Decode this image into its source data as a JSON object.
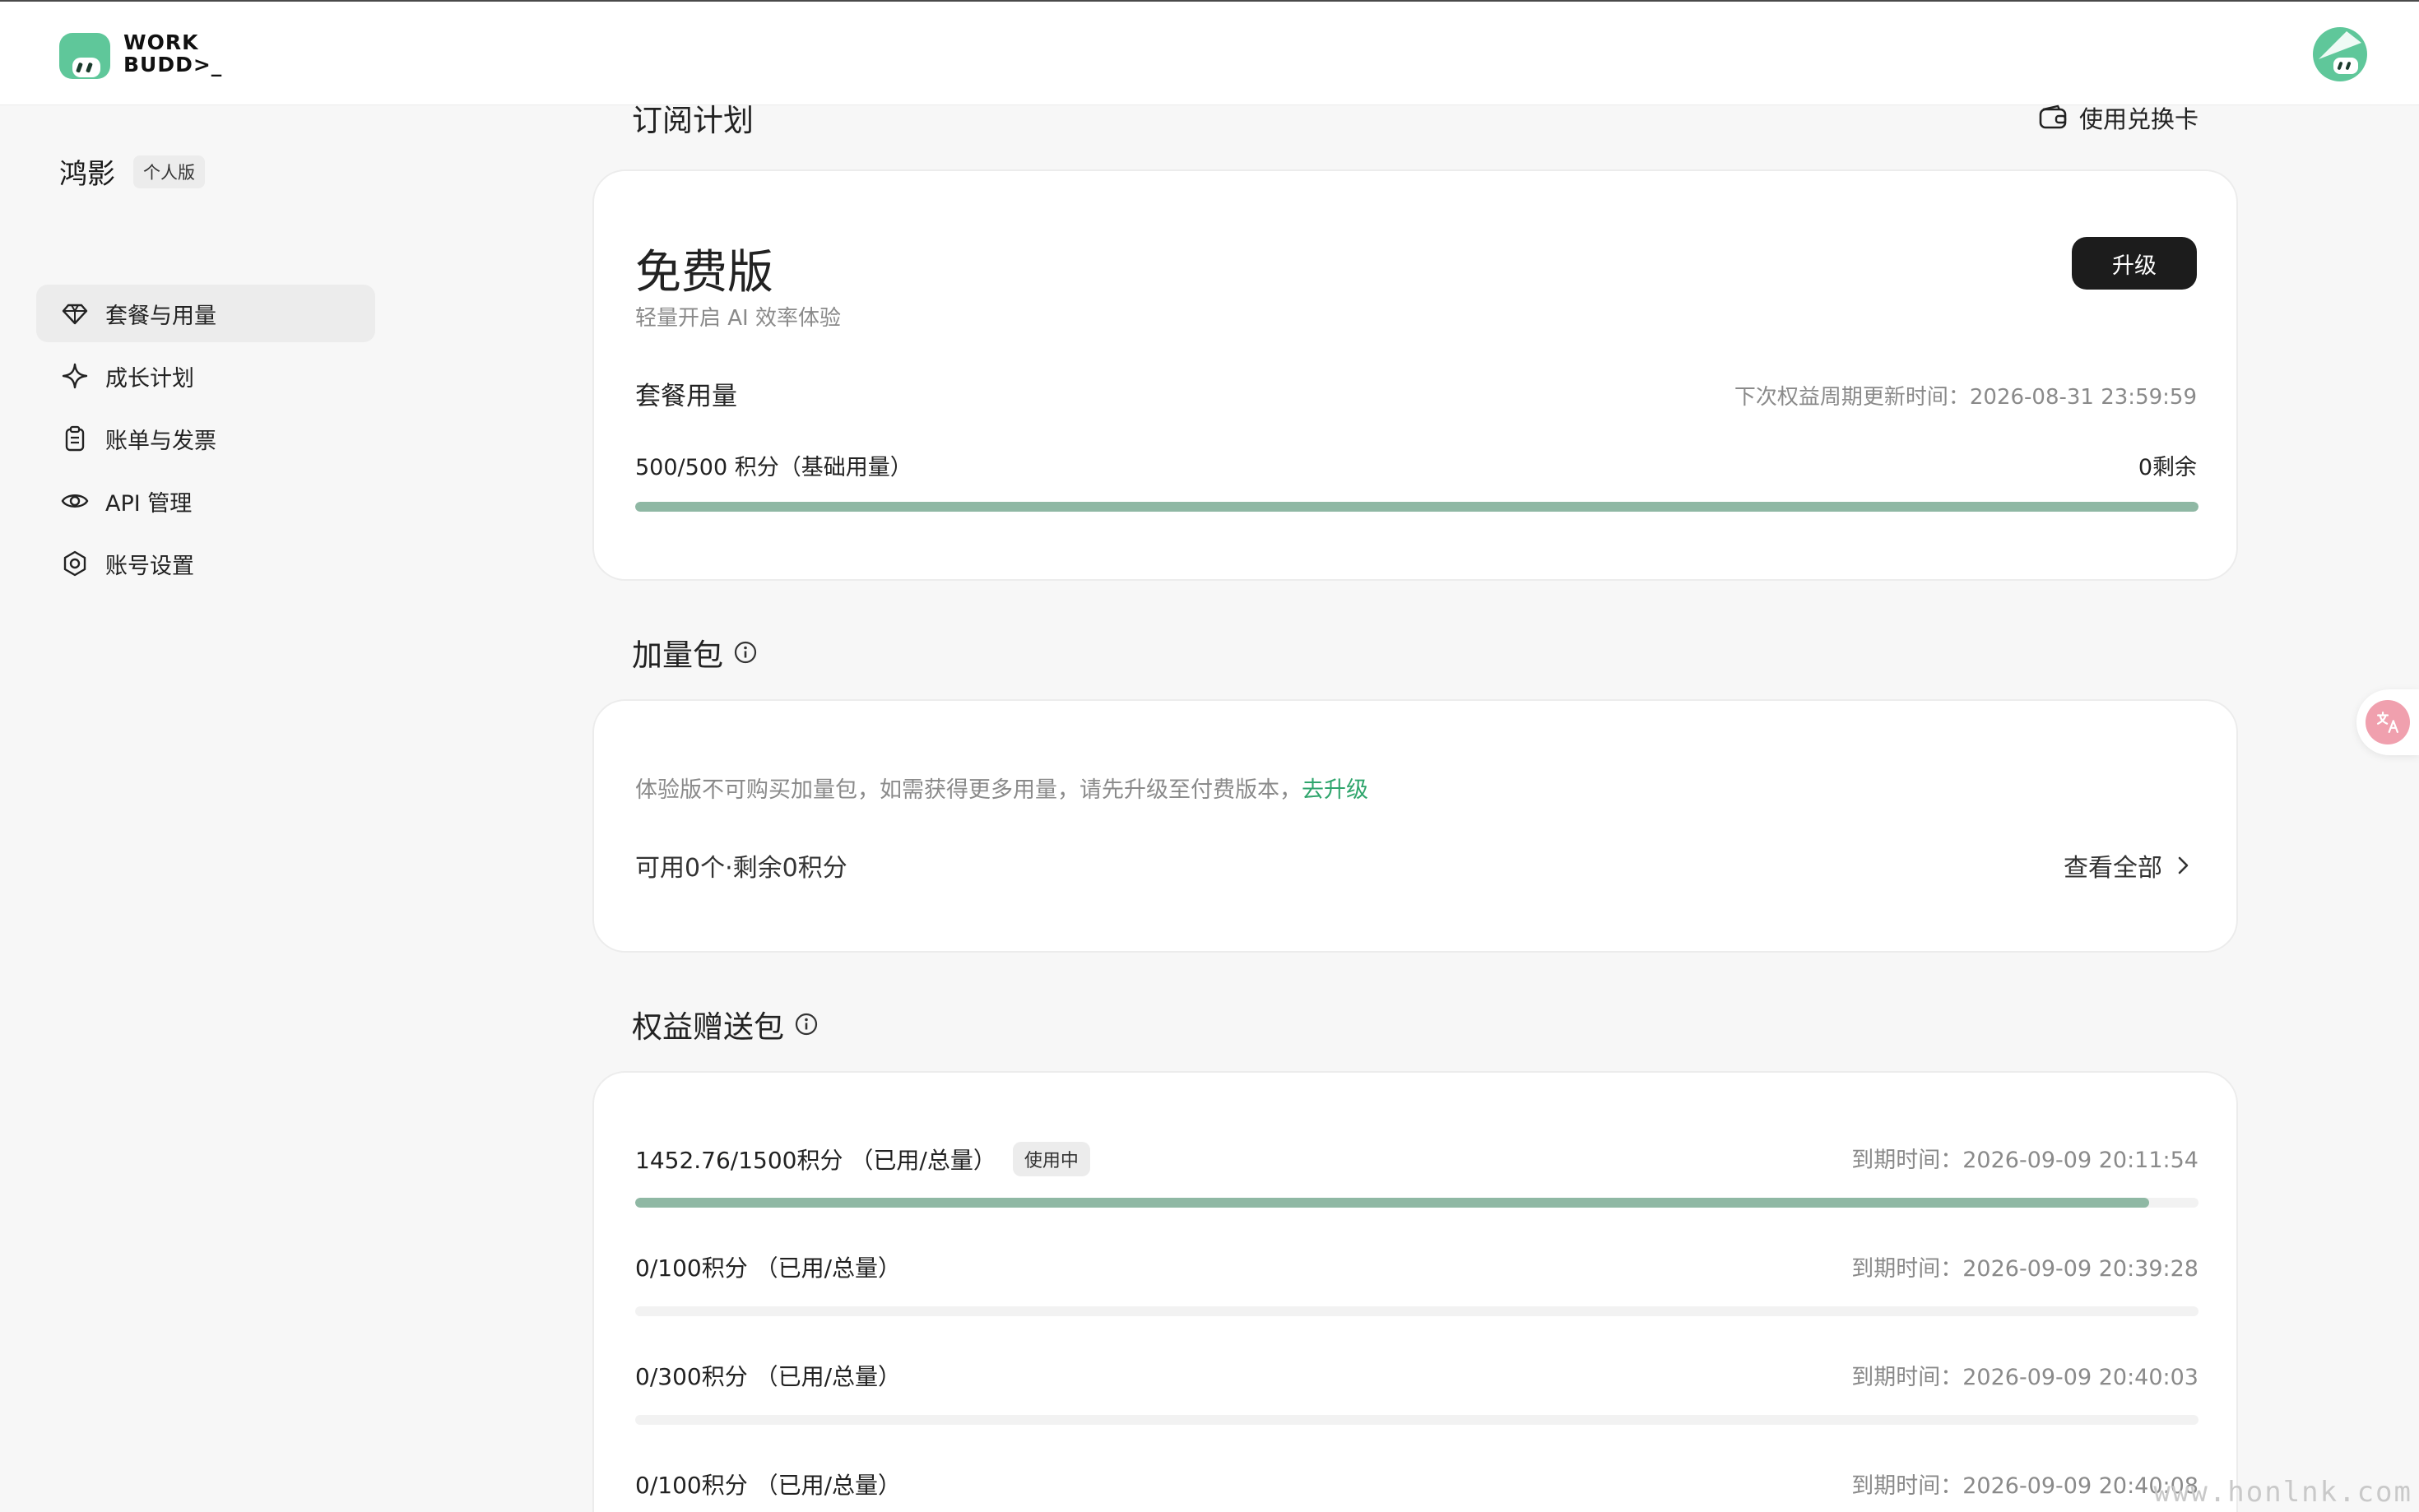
{
  "header": {
    "logo_line1": "WORK",
    "logo_line2": "BUDD>_"
  },
  "sidebar": {
    "org_name": "鸿影",
    "org_tag": "个人版",
    "items": [
      {
        "label": "套餐与用量",
        "icon": "gem-icon",
        "active": true
      },
      {
        "label": "成长计划",
        "icon": "sparkle-icon",
        "active": false
      },
      {
        "label": "账单与发票",
        "icon": "clipboard-icon",
        "active": false
      },
      {
        "label": "API 管理",
        "icon": "eye-icon",
        "active": false
      },
      {
        "label": "账号设置",
        "icon": "settings-icon",
        "active": false
      }
    ]
  },
  "subscription": {
    "title": "订阅计划",
    "redeem_label": "使用兑换卡",
    "plan_name": "免费版",
    "plan_desc": "轻量开启 AI 效率体验",
    "upgrade_label": "升级",
    "usage_title": "套餐用量",
    "refresh_time": "下次权益周期更新时间：2026-08-31 23:59:59",
    "usage_text": "500/500 积分（基础用量）",
    "remaining": "0剩余",
    "usage_fraction": 1.0
  },
  "addon": {
    "title": "加量包",
    "note": "体验版不可购买加量包，如需获得更多用量，请先升级至付费版本，",
    "note_link": "去升级",
    "available": "可用0个·剩余0积分",
    "view_all": "查看全部"
  },
  "gifts": {
    "title": "权益赠送包",
    "rows": [
      {
        "text": "1452.76/1500积分 （已用/总量）",
        "badge": "使用中",
        "expiry": "到期时间：2026-09-09 20:11:54",
        "fraction": 0.9685
      },
      {
        "text": "0/100积分 （已用/总量）",
        "badge": "",
        "expiry": "到期时间：2026-09-09 20:39:28",
        "fraction": 0
      },
      {
        "text": "0/300积分 （已用/总量）",
        "badge": "",
        "expiry": "到期时间：2026-09-09 20:40:03",
        "fraction": 0
      },
      {
        "text": "0/100积分 （已用/总量）",
        "badge": "",
        "expiry": "到期时间：2026-09-09 20:40:08",
        "fraction": 0
      }
    ]
  },
  "watermark": "www.honlnk.com",
  "colors": {
    "accent_green": "#2fa56c",
    "progress": "#8fb8a4",
    "button_dark": "#1c1c1c"
  }
}
